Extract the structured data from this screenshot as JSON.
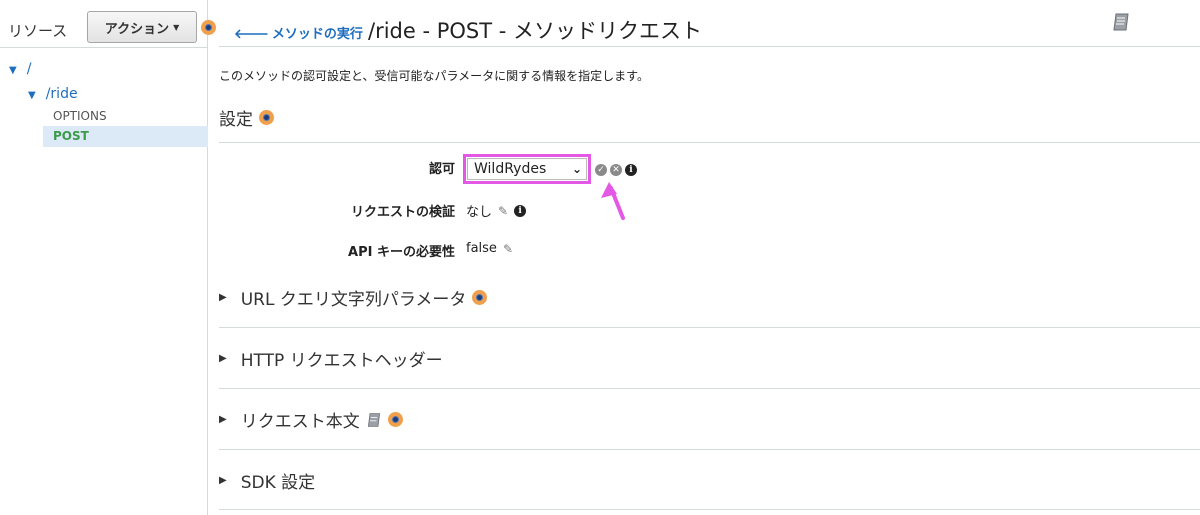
{
  "sidebar": {
    "resources_label": "リソース",
    "actions_label": "アクション",
    "tree": {
      "root": "/",
      "ride": "/ride",
      "options": "OPTIONS",
      "post": "POST"
    }
  },
  "header": {
    "back_label": "メソッドの実行",
    "title": "/ride - POST - メソッドリクエスト"
  },
  "description": "このメソッドの認可設定と、受信可能なパラメータに関する情報を指定します。",
  "settings": {
    "title": "設定",
    "authorization_label": "認可",
    "authorization_value": "WildRydes",
    "validation_label": "リクエストの検証",
    "validation_value": "なし",
    "apikey_label": "API キーの必要性",
    "apikey_value": "false"
  },
  "sections": {
    "url_params": "URL クエリ文字列パラメータ",
    "http_headers": "HTTP リクエストヘッダー",
    "request_body": "リクエスト本文",
    "sdk_settings": "SDK 設定"
  },
  "colors": {
    "link": "#1e6ebf",
    "selected_bg": "#dce9f7",
    "selected_text": "#3c9a4b",
    "highlight": "#e458e6",
    "info_dot": "#f0a04b"
  }
}
